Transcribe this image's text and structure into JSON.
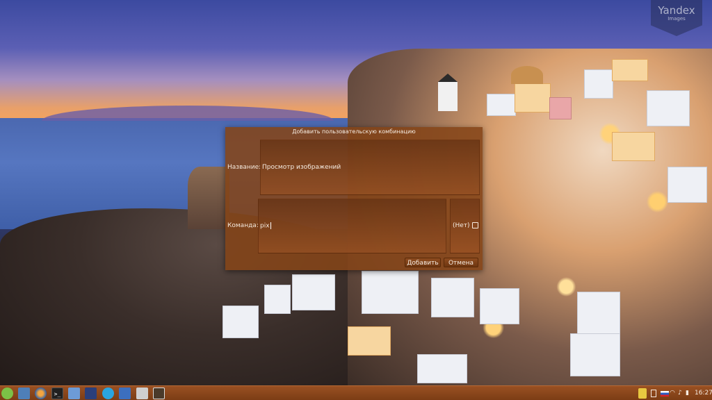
{
  "watermark": {
    "title": "Yandex",
    "subtitle": "Images"
  },
  "dialog": {
    "title": "Добавить пользовательскую комбинацию",
    "name_label": "Название:",
    "name_value": "Просмотр изображений",
    "command_label": "Команда:",
    "command_value": "pix",
    "shortcut_label": "(Нет)",
    "add_button": "Добавить",
    "cancel_button": "Отмена"
  },
  "taskbar": {
    "apps": [
      {
        "icon": "menu-icon"
      },
      {
        "icon": "show-desktop-icon"
      },
      {
        "icon": "firefox-icon"
      },
      {
        "icon": "terminal-icon",
        "glyph": ">_"
      },
      {
        "icon": "folder-icon"
      },
      {
        "icon": "media-player-icon"
      },
      {
        "icon": "skype-icon"
      },
      {
        "icon": "document-icon"
      },
      {
        "icon": "calculator-icon"
      },
      {
        "icon": "app-icon"
      }
    ],
    "tray": {
      "clock": "16:27"
    }
  },
  "colors": {
    "dialog_bg": "#844418",
    "taskbar_bg": "#8a4619",
    "accent_green": "#7cc146"
  }
}
